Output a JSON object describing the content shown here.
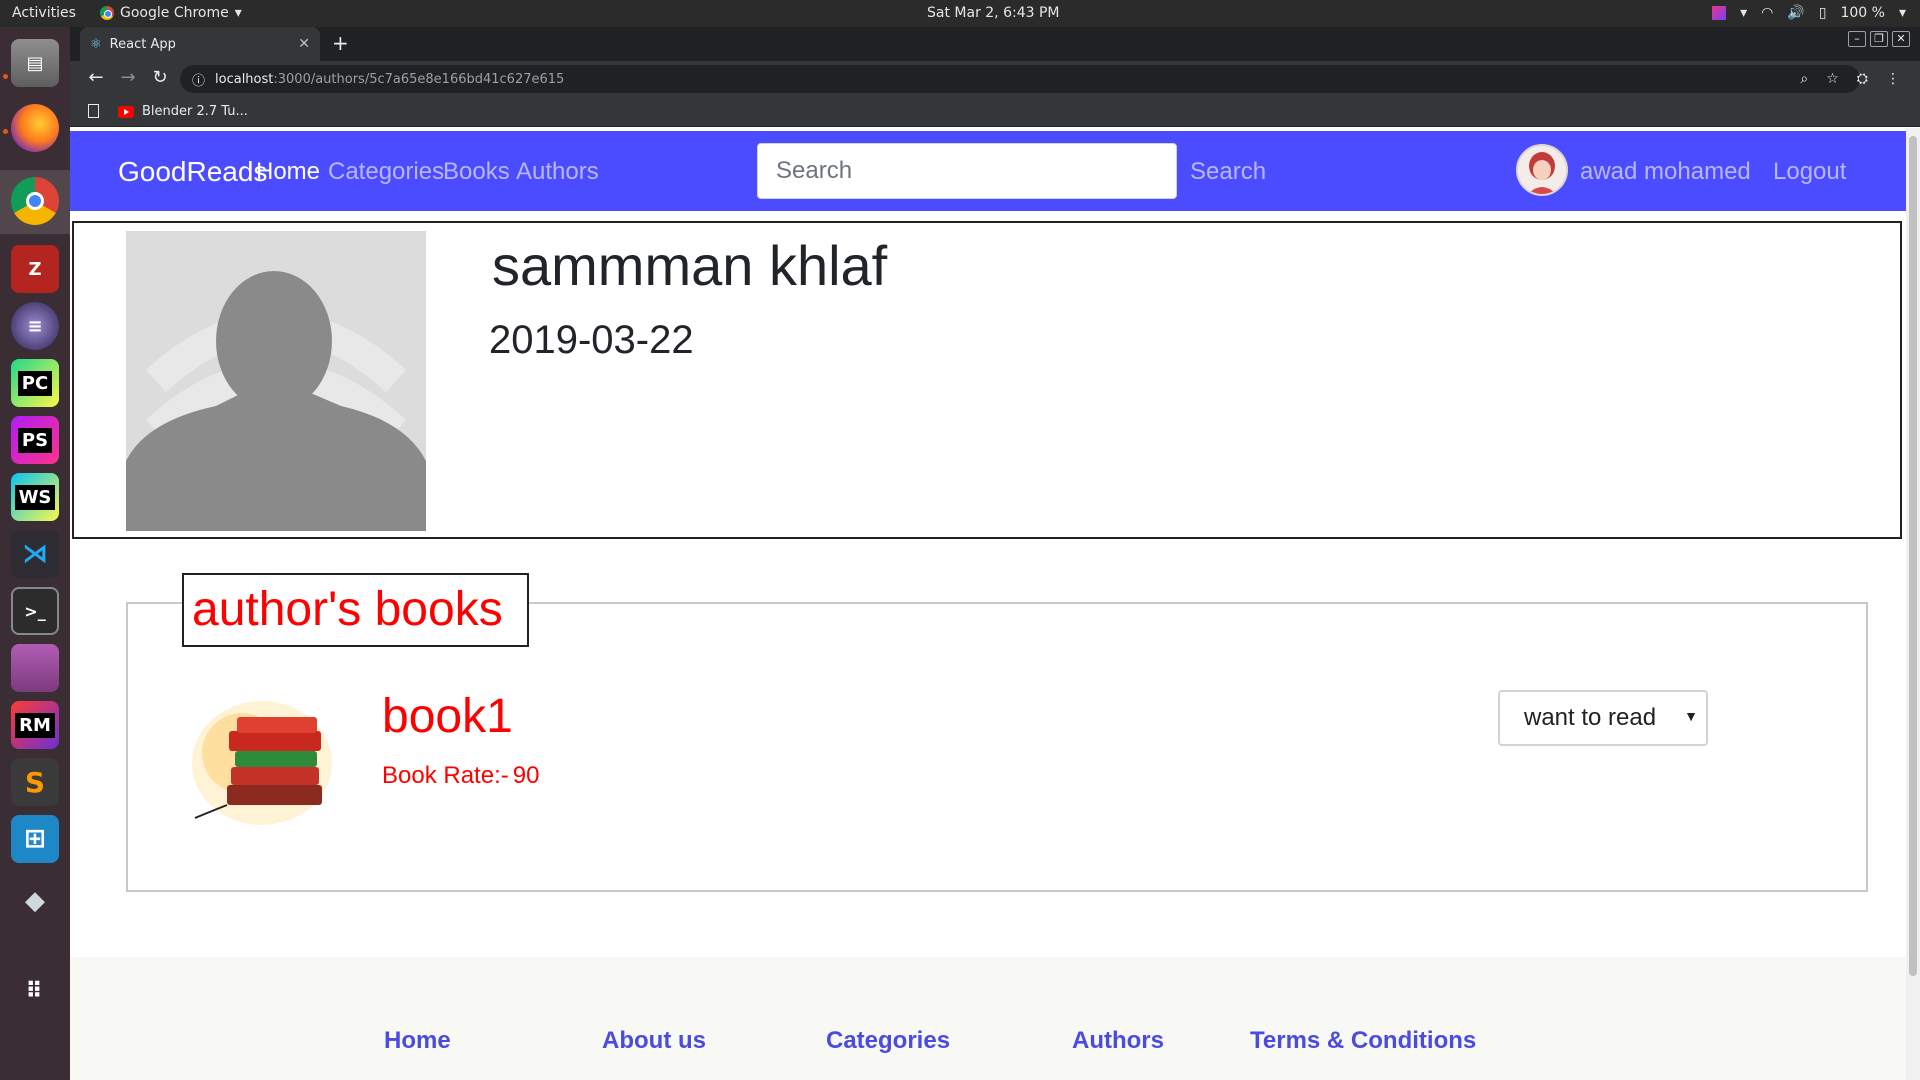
{
  "system": {
    "activities": "Activities",
    "app_name": "Google Chrome",
    "clock": "Sat Mar  2,  6:43 PM",
    "battery": "100 %"
  },
  "browser": {
    "tab_title": "React App",
    "url_host": "localhost",
    "url_path": ":3000/authors/5c7a65e8e166bd41c627e615",
    "bookmark": "Blender 2.7 Tu..."
  },
  "navbar": {
    "brand": "GoodReads",
    "links": [
      "Home",
      "Categories",
      "Books",
      "Authors"
    ],
    "active_link": "Home",
    "search_placeholder": "Search",
    "search_button": "Search",
    "user_name": "awad mohamed",
    "logout": "Logout",
    "color": "#4b4bff"
  },
  "author": {
    "name": "sammman khlaf",
    "date": "2019-03-22"
  },
  "books_section": {
    "legend": "author's books",
    "books": [
      {
        "title": "book1",
        "rate_label": "Book Rate:-",
        "rate_value": "90",
        "shelf_status": "want to read"
      }
    ],
    "accent_color": "#ff0000"
  },
  "footer": {
    "links": [
      "Home",
      "About us",
      "Categories",
      "Authors",
      "Terms & Conditions"
    ],
    "link_color": "#4b4be0"
  },
  "dock": {
    "apps": [
      "files-icon",
      "firefox-icon",
      "chrome-icon",
      "filezilla-icon",
      "eclipse-icon",
      "pycharm-icon",
      "phpstorm-icon",
      "webstorm-icon",
      "vscode-icon",
      "terminal-icon",
      "window-icon",
      "robomongo-icon",
      "sublime-icon",
      "screenshot-icon",
      "disk-icon",
      "app-grid-icon"
    ]
  }
}
